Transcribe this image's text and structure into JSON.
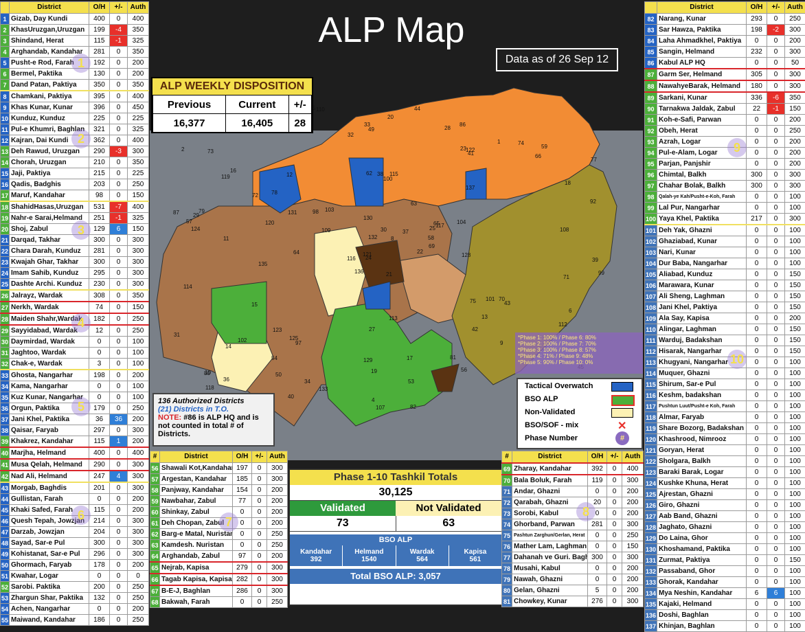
{
  "title": "ALP Map",
  "as_of": "Data as of 26 Sep 12",
  "disposition": {
    "title": "ALP WEEKLY DISPOSITION",
    "previous_label": "Previous",
    "current_label": "Current",
    "delta_label": "+/-",
    "previous": "16,377",
    "current": "16,405",
    "delta": "28"
  },
  "headers": {
    "district": "District",
    "oh": "O/H",
    "pm": "+/-",
    "auth": "Auth",
    "num": "#"
  },
  "left_rows": [
    [
      "1",
      "Gizab, Day Kundi",
      "400",
      "0",
      "400",
      "blue"
    ],
    [
      "2",
      "KhasUruzgan,Uruzgan",
      "199",
      "-4",
      "350",
      "green"
    ],
    [
      "3",
      "Shindand, Herat",
      "115",
      "-1",
      "325",
      "green"
    ],
    [
      "4",
      "Arghandab, Kandahar",
      "281",
      "0",
      "350",
      "green"
    ],
    [
      "5",
      "Pusht-e Rod, Farah",
      "192",
      "0",
      "200",
      "blue"
    ],
    [
      "6",
      "Bermel, Paktika",
      "130",
      "0",
      "200",
      "green"
    ],
    [
      "7",
      "Dand Patan, Paktiya",
      "350",
      "0",
      "350",
      "green"
    ],
    [
      "8",
      "Chamkani, Paktiya",
      "395",
      "0",
      "400",
      "blue"
    ],
    [
      "9",
      "Khas Kunar, Kunar",
      "396",
      "0",
      "450",
      "blue"
    ],
    [
      "10",
      "Kunduz, Kunduz",
      "225",
      "0",
      "225",
      "blue"
    ],
    [
      "11",
      "Pul-e Khumri, Baghlan",
      "321",
      "0",
      "325",
      "blue"
    ],
    [
      "12",
      "Kajran, Dai Kundi",
      "362",
      "0",
      "400",
      "blue"
    ],
    [
      "13",
      "Deh Rawud, Uruzgan",
      "290",
      "-3",
      "300",
      "green"
    ],
    [
      "14",
      "Chorah, Uruzgan",
      "210",
      "0",
      "350",
      "green"
    ],
    [
      "15",
      "Jaji, Paktiya",
      "215",
      "0",
      "225",
      "blue"
    ],
    [
      "16",
      "Qadis, Badghis",
      "203",
      "0",
      "250",
      "blue"
    ],
    [
      "17",
      "Maruf, Kandahar",
      "98",
      "0",
      "150",
      "green"
    ],
    [
      "18",
      "ShahidHasas,Uruzgan",
      "531",
      "-7",
      "400",
      "green"
    ],
    [
      "19",
      "Nahr-e Sarai,Helmand",
      "251",
      "-1",
      "325",
      "green"
    ],
    [
      "20",
      "Shoj, Zabul",
      "129",
      "6",
      "150",
      "green"
    ],
    [
      "21",
      "Darqad, Takhar",
      "300",
      "0",
      "300",
      "blue"
    ],
    [
      "22",
      "Chara Darah, Kunduz",
      "281",
      "0",
      "300",
      "blue"
    ],
    [
      "23",
      "Kwajah Ghar, Takhar",
      "300",
      "0",
      "300",
      "blue"
    ],
    [
      "24",
      "Imam Sahib, Kunduz",
      "295",
      "0",
      "300",
      "blue"
    ],
    [
      "25",
      "Dashte Archi. Kunduz",
      "230",
      "0",
      "300",
      "blue"
    ],
    [
      "26",
      "Jalrayz, Wardak",
      "308",
      "0",
      "350",
      "green"
    ],
    [
      "27",
      "Nerkh, Wardak",
      "74",
      "0",
      "150",
      "green"
    ],
    [
      "28",
      "Maiden Shahr,Wardak",
      "182",
      "0",
      "250",
      "green"
    ],
    [
      "29",
      "Sayyidabad, Wardak",
      "12",
      "0",
      "250",
      "green"
    ],
    [
      "30",
      "Daymirdad, Wardak",
      "0",
      "0",
      "100",
      "green"
    ],
    [
      "31",
      "Jaghtoo, Wardak",
      "0",
      "0",
      "100",
      "green"
    ],
    [
      "32",
      "Chak-e, Wardak",
      "3",
      "0",
      "100",
      "green"
    ],
    [
      "33",
      "Ghosta, Nangarhar",
      "198",
      "0",
      "200",
      "blue"
    ],
    [
      "34",
      "Kama, Nangarhar",
      "0",
      "0",
      "100",
      "blue"
    ],
    [
      "35",
      "Kuz Kunar, Nangarhar",
      "0",
      "0",
      "100",
      "blue"
    ],
    [
      "36",
      "Orgun, Paktika",
      "179",
      "0",
      "250",
      "blue"
    ],
    [
      "37",
      "Jani Khel, Paktika",
      "36",
      "36",
      "200",
      "blue"
    ],
    [
      "38",
      "Qaisar, Faryab",
      "297",
      "0",
      "300",
      "blue"
    ],
    [
      "39",
      "Khakrez, Kandahar",
      "115",
      "1",
      "200",
      "green"
    ],
    [
      "40",
      "Marjha, Helmand",
      "400",
      "0",
      "400",
      "green"
    ],
    [
      "41",
      "Musa Qelah, Helmand",
      "290",
      "0",
      "300",
      "green"
    ],
    [
      "42",
      "Nad Ali, Helmand",
      "247",
      "4",
      "300",
      "green"
    ],
    [
      "43",
      "Morgab, Baghdis",
      "201",
      "0",
      "300",
      "blue"
    ],
    [
      "44",
      "Gullistan, Farah",
      "0",
      "0",
      "200",
      "blue"
    ],
    [
      "45",
      "Khaki Safed, Farah",
      "115",
      "0",
      "200",
      "blue"
    ],
    [
      "46",
      "Quesh Tepah, Jowzjan",
      "214",
      "0",
      "300",
      "blue"
    ],
    [
      "47",
      "Darzab, Jowzjan",
      "204",
      "0",
      "300",
      "blue"
    ],
    [
      "48",
      "Sayad, Sar-e Pul",
      "300",
      "0",
      "300",
      "blue"
    ],
    [
      "49",
      "Kohistanat, Sar-e Pul",
      "296",
      "0",
      "300",
      "blue"
    ],
    [
      "50",
      "Ghormach, Faryab",
      "178",
      "0",
      "200",
      "blue"
    ],
    [
      "51",
      "Kwahar, Logar",
      "0",
      "0",
      "0",
      "blue"
    ],
    [
      "52",
      "Sarobi. Paktika",
      "200",
      "0",
      "250",
      "green"
    ],
    [
      "53",
      "Zhargun Shar, Paktika",
      "132",
      "0",
      "250",
      "blue"
    ],
    [
      "54",
      "Achen, Nangarhar",
      "0",
      "0",
      "200",
      "blue"
    ],
    [
      "55",
      "Maiwand, Kandahar",
      "186",
      "0",
      "250",
      "blue"
    ]
  ],
  "mid_rows": [
    [
      "56",
      "Shawali Kot,Kandahar",
      "197",
      "0",
      "300"
    ],
    [
      "57",
      "Argestan, Kandahar",
      "185",
      "0",
      "300"
    ],
    [
      "58",
      "Panjway, Kandahar",
      "154",
      "0",
      "200"
    ],
    [
      "59",
      "Nawbahar, Zabul",
      "77",
      "0",
      "200"
    ],
    [
      "60",
      "Shinkay, Zabul",
      "0",
      "0",
      "200"
    ],
    [
      "61",
      "Deh Chopan, Zabul",
      "0",
      "0",
      "200"
    ],
    [
      "62",
      "Barg-e Matal, Nuristan",
      "0",
      "0",
      "250"
    ],
    [
      "63",
      "Kamdesh. Nuristan",
      "0",
      "0",
      "250"
    ],
    [
      "64",
      "Arghandab, Zabul",
      "97",
      "0",
      "200"
    ],
    [
      "65",
      "Nejrab, Kapisa",
      "279",
      "0",
      "300"
    ],
    [
      "66",
      "Tagab Kapisa, Kapisa",
      "282",
      "0",
      "300"
    ],
    [
      "67",
      "B-E-J, Baghlan",
      "286",
      "0",
      "300"
    ],
    [
      "68",
      "Bakwah, Farah",
      "0",
      "0",
      "250"
    ]
  ],
  "right_mid_rows": [
    [
      "69",
      "Zharay, Kandahar",
      "392",
      "0",
      "400"
    ],
    [
      "70",
      "Bala Boluk, Farah",
      "119",
      "0",
      "300"
    ],
    [
      "71",
      "Andar, Ghazni",
      "0",
      "0",
      "200"
    ],
    [
      "72",
      "Qarabah, Ghazni",
      "20",
      "0",
      "200"
    ],
    [
      "73",
      "Sorobi, Kabul",
      "0",
      "0",
      "200"
    ],
    [
      "74",
      "Ghorband, Parwan",
      "281",
      "0",
      "300"
    ],
    [
      "75",
      "Pashtun Zarghun/Gerlan, Herat",
      "0",
      "0",
      "250"
    ],
    [
      "76",
      "Mather Lam, Laghman",
      "0",
      "0",
      "150"
    ],
    [
      "77",
      "Dahanah ve Guri. Baghlan",
      "300",
      "0",
      "300"
    ],
    [
      "78",
      "Musahi, Kabul",
      "0",
      "0",
      "200"
    ],
    [
      "79",
      "Nawah, Ghazni",
      "0",
      "0",
      "200"
    ],
    [
      "80",
      "Gelan, Ghazni",
      "5",
      "0",
      "200"
    ],
    [
      "81",
      "Chowkey, Kunar",
      "276",
      "0",
      "300"
    ]
  ],
  "right_rows": [
    [
      "82",
      "Narang, Kunar",
      "293",
      "0",
      "250"
    ],
    [
      "83",
      "Sar Hawza, Paktika",
      "198",
      "-2",
      "300"
    ],
    [
      "84",
      "Laha Ahmadkhel, Paktiya",
      "0",
      "0",
      "200"
    ],
    [
      "85",
      "Sangin, Helmand",
      "232",
      "0",
      "300"
    ],
    [
      "86",
      "Kabul ALP HQ",
      "0",
      "0",
      "50"
    ],
    [
      "87",
      "Garm Ser, Helmand",
      "305",
      "0",
      "300"
    ],
    [
      "88",
      "NawahyeBarak, Helmand",
      "180",
      "0",
      "300"
    ],
    [
      "89",
      "Sarkani, Kunar",
      "336",
      "-6",
      "350"
    ],
    [
      "90",
      "Tarnakwa Jaldak, Zabul",
      "22",
      "-1",
      "150"
    ],
    [
      "91",
      "Koh-e-Safi, Parwan",
      "0",
      "0",
      "200"
    ],
    [
      "92",
      "Obeh, Herat",
      "0",
      "0",
      "250"
    ],
    [
      "93",
      "Azrah, Logar",
      "0",
      "0",
      "200"
    ],
    [
      "94",
      "Pul-e-Alam, Logar",
      "0",
      "0",
      "200"
    ],
    [
      "95",
      "Parjan, Panjshir",
      "0",
      "0",
      "200"
    ],
    [
      "96",
      "Chimtal, Balkh",
      "300",
      "0",
      "300"
    ],
    [
      "97",
      "Chahar Bolak, Balkh",
      "300",
      "0",
      "300"
    ],
    [
      "98",
      "Qalah-ye Kah/Pusht-e-Koh, Farah",
      "0",
      "0",
      "100"
    ],
    [
      "99",
      "Lal Pur, Nangarhar",
      "0",
      "0",
      "100"
    ],
    [
      "100",
      "Yaya Khel, Paktika",
      "217",
      "0",
      "300"
    ],
    [
      "101",
      "Deh Yak, Ghazni",
      "0",
      "0",
      "100"
    ],
    [
      "102",
      "Ghaziabad, Kunar",
      "0",
      "0",
      "100"
    ],
    [
      "103",
      "Nari, Kunar",
      "0",
      "0",
      "100"
    ],
    [
      "104",
      "Dur Baba, Nangarhar",
      "0",
      "0",
      "100"
    ],
    [
      "105",
      "Aliabad, Kunduz",
      "0",
      "0",
      "150"
    ],
    [
      "106",
      "Marawara, Kunar",
      "0",
      "0",
      "150"
    ],
    [
      "107",
      "Ali Sheng, Laghman",
      "0",
      "0",
      "150"
    ],
    [
      "108",
      "Jani Khel, Paktiya",
      "0",
      "0",
      "150"
    ],
    [
      "109",
      "Ala Say, Kapisa",
      "0",
      "0",
      "200"
    ],
    [
      "110",
      "Alingar, Laghman",
      "0",
      "0",
      "150"
    ],
    [
      "111",
      "Warduj, Badakshan",
      "0",
      "0",
      "150"
    ],
    [
      "112",
      "Hisarak, Nangarhar",
      "0",
      "0",
      "150"
    ],
    [
      "113",
      "Khugyani, Nangarhar",
      "0",
      "0",
      "100"
    ],
    [
      "114",
      "Muquer, Ghazni",
      "0",
      "0",
      "100"
    ],
    [
      "115",
      "Shirum, Sar-e Pul",
      "0",
      "0",
      "100"
    ],
    [
      "116",
      "Keshm, badakshan",
      "0",
      "0",
      "100"
    ],
    [
      "117",
      "Pushtun Luut/Pusht-e Koh, Farah",
      "0",
      "0",
      "100"
    ],
    [
      "118",
      "Almar, Faryab",
      "0",
      "0",
      "100"
    ],
    [
      "119",
      "Share Bozorg, Badakshan",
      "0",
      "0",
      "100"
    ],
    [
      "120",
      "Khashrood, Nimrooz",
      "0",
      "0",
      "100"
    ],
    [
      "121",
      "Goryan, Herat",
      "0",
      "0",
      "100"
    ],
    [
      "122",
      "Sholgara, Balkh",
      "0",
      "0",
      "100"
    ],
    [
      "123",
      "Baraki Barak, Logar",
      "0",
      "0",
      "100"
    ],
    [
      "124",
      "Kushke Khuna, Herat",
      "0",
      "0",
      "100"
    ],
    [
      "125",
      "Ajrestan, Ghazni",
      "0",
      "0",
      "100"
    ],
    [
      "126",
      "Giro, Ghazni",
      "0",
      "0",
      "100"
    ],
    [
      "127",
      "Aab Band, Ghazni",
      "0",
      "0",
      "100"
    ],
    [
      "128",
      "Jaghato, Ghazni",
      "0",
      "0",
      "100"
    ],
    [
      "129",
      "Do Laina, Ghor",
      "0",
      "0",
      "100"
    ],
    [
      "130",
      "Khoshamand, Paktika",
      "0",
      "0",
      "100"
    ],
    [
      "131",
      "Zurmat, Paktiya",
      "0",
      "0",
      "150"
    ],
    [
      "132",
      "Passaband, Ghor",
      "0",
      "0",
      "100"
    ],
    [
      "133",
      "Ghorak, Kandahar",
      "0",
      "0",
      "100"
    ],
    [
      "134",
      "Mya Neshin, Kandahar",
      "6",
      "6",
      "100"
    ],
    [
      "135",
      "Kajaki, Helmand",
      "0",
      "0",
      "100"
    ],
    [
      "136",
      "Doshi, Baghlan",
      "0",
      "0",
      "100"
    ],
    [
      "137",
      "Khinjan, Baghlan",
      "0",
      "0",
      "100"
    ]
  ],
  "auth_box": {
    "title": "136 Authorized Districts",
    "line2": "(21) Districts in T.O.",
    "note_label": "NOTE:",
    "note": "#86 is ALP HQ and is not counted in total # of Districts."
  },
  "legend": {
    "tactical": "Tactical Overwatch",
    "bso": "BSO ALP",
    "nonval": "Non-Validated",
    "mix": "BSO/SOF - mix",
    "phase": "Phase Number",
    "phase_symbol": "#"
  },
  "phases": [
    "*Phase 1: 100%  /  Phase 6: 80%",
    "*Phase 2: 100%  /  Phase 7: 70%",
    "*Phase 3: 100%  /  Phase 8: 57%",
    "*Phase 4:   71%  /  Phase 9: 48%",
    "*Phase 5:   90%  /  Phase 10: 0%"
  ],
  "phase_markers": [
    "1",
    "2",
    "3",
    "4",
    "5",
    "6",
    "7",
    "8",
    "9",
    "10"
  ],
  "tashkil": {
    "title": "Phase 1-10 Tashkil Totals",
    "total": "30,125",
    "validated_label": "Validated",
    "not_validated_label": "Not Validated",
    "validated": "73",
    "not_validated": "63",
    "bso_label": "BSO ALP",
    "provinces": [
      [
        "Kandahar",
        "392"
      ],
      [
        "Helmand",
        "1540"
      ],
      [
        "Wardak",
        "564"
      ],
      [
        "Kapisa",
        "561"
      ]
    ],
    "total_bso": "Total BSO ALP:  3,057"
  },
  "map_labels": [
    "21",
    "119",
    "24",
    "10",
    "25",
    "97",
    "86",
    "115",
    "122",
    "22",
    "105",
    "67",
    "11",
    "77",
    "136",
    "137",
    "95",
    "62",
    "63",
    "102",
    "103",
    "118",
    "50",
    "38",
    "117",
    "43",
    "16",
    "49",
    "124",
    "75",
    "92",
    "121",
    "129",
    "132",
    "12",
    "1",
    "125",
    "3",
    "45",
    "70",
    "44",
    "98",
    "120",
    "42",
    "40",
    "87",
    "58",
    "55",
    "19",
    "69",
    "14",
    "18",
    "2",
    "13",
    "56",
    "54",
    "60",
    "90",
    "17",
    "59",
    "20",
    "64",
    "79",
    "78",
    "74",
    "26",
    "28",
    "32",
    "30",
    "31",
    "27",
    "133",
    "101",
    "131",
    "80",
    "83",
    "72",
    "114",
    "130",
    "53",
    "37",
    "36",
    "128",
    "6",
    "4",
    "108",
    "113",
    "89",
    "82",
    "81",
    "33",
    "99",
    "104",
    "9",
    "8",
    "112",
    "29",
    "107",
    "23",
    "41",
    "135",
    "85",
    "39",
    "57",
    "15",
    "123",
    "34",
    "65",
    "66",
    "109",
    "71",
    "73",
    "100",
    "116",
    "110"
  ],
  "colors": {
    "orange": "#f28c34",
    "brown": "#a9744a",
    "darkbrown": "#5a3312",
    "olive": "#a1902e",
    "green": "#4caf3a",
    "blue": "#2463c4",
    "cream": "#fcf1b4",
    "tan": "#d39b6a",
    "yellow": "#f4e04d",
    "red": "#e8302a"
  }
}
